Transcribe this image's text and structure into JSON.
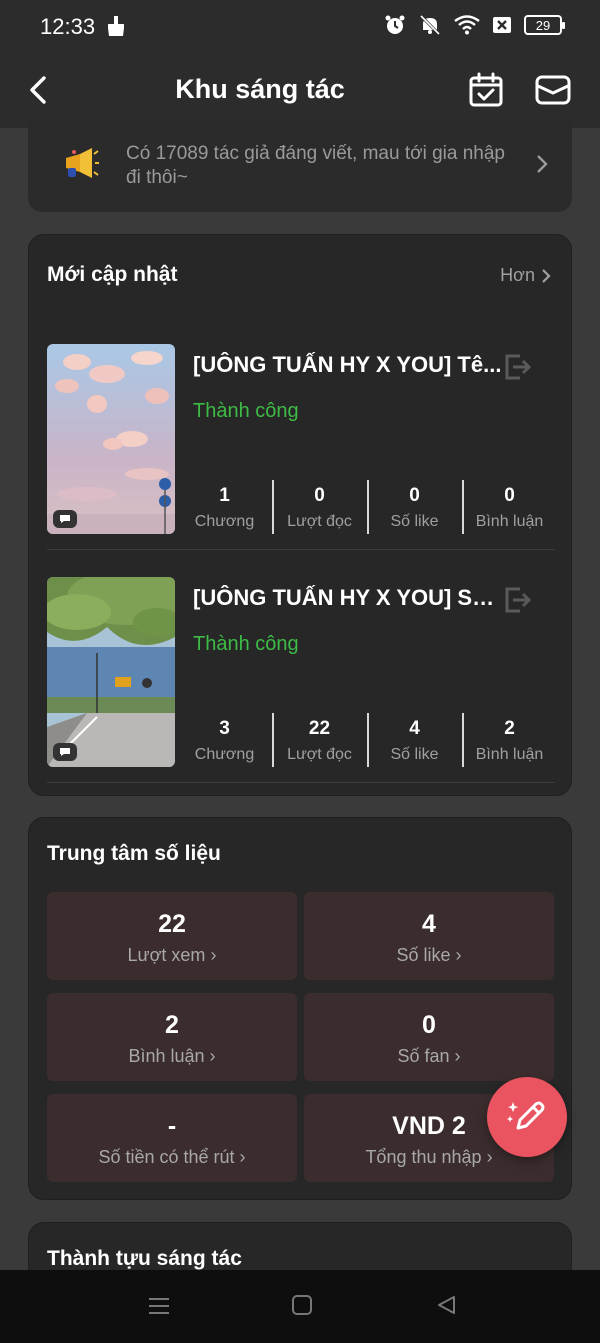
{
  "status_bar": {
    "time": "12:33",
    "battery": "29"
  },
  "header": {
    "title": "Khu sáng tác"
  },
  "announcement": {
    "text": "Có 17089 tác giả đáng viết, mau tới gia nhập đi thôi~"
  },
  "recent": {
    "title": "Mới cập nhật",
    "more_label": "Hơn",
    "stories": [
      {
        "name": "[UÔNG TUẤN HY X YOU] Tê...",
        "status": "Thành công",
        "stats": [
          {
            "value": "1",
            "label": "Chương"
          },
          {
            "value": "0",
            "label": "Lượt đọc"
          },
          {
            "value": "0",
            "label": "Số like"
          },
          {
            "value": "0",
            "label": "Bình luận"
          }
        ]
      },
      {
        "name": "[UÔNG TUẤN HY X YOU] Sự...",
        "status": "Thành công",
        "stats": [
          {
            "value": "3",
            "label": "Chương"
          },
          {
            "value": "22",
            "label": "Lượt đọc"
          },
          {
            "value": "4",
            "label": "Số like"
          },
          {
            "value": "2",
            "label": "Bình luận"
          }
        ]
      }
    ]
  },
  "data_center": {
    "title": "Trung tâm số liệu",
    "tiles": [
      {
        "value": "22",
        "label": "Lượt xem"
      },
      {
        "value": "4",
        "label": "Số like"
      },
      {
        "value": "2",
        "label": "Bình luận"
      },
      {
        "value": "0",
        "label": "Số fan"
      },
      {
        "value": "-",
        "label": "Số tiền có thể rút"
      },
      {
        "value": "VND 2",
        "label": "Tổng thu nhập"
      }
    ]
  },
  "achievements": {
    "title": "Thành tựu sáng tác"
  },
  "colors": {
    "success": "#3dbb45",
    "fab": "#ea5461",
    "tile_bg": "#3b2d2d"
  }
}
